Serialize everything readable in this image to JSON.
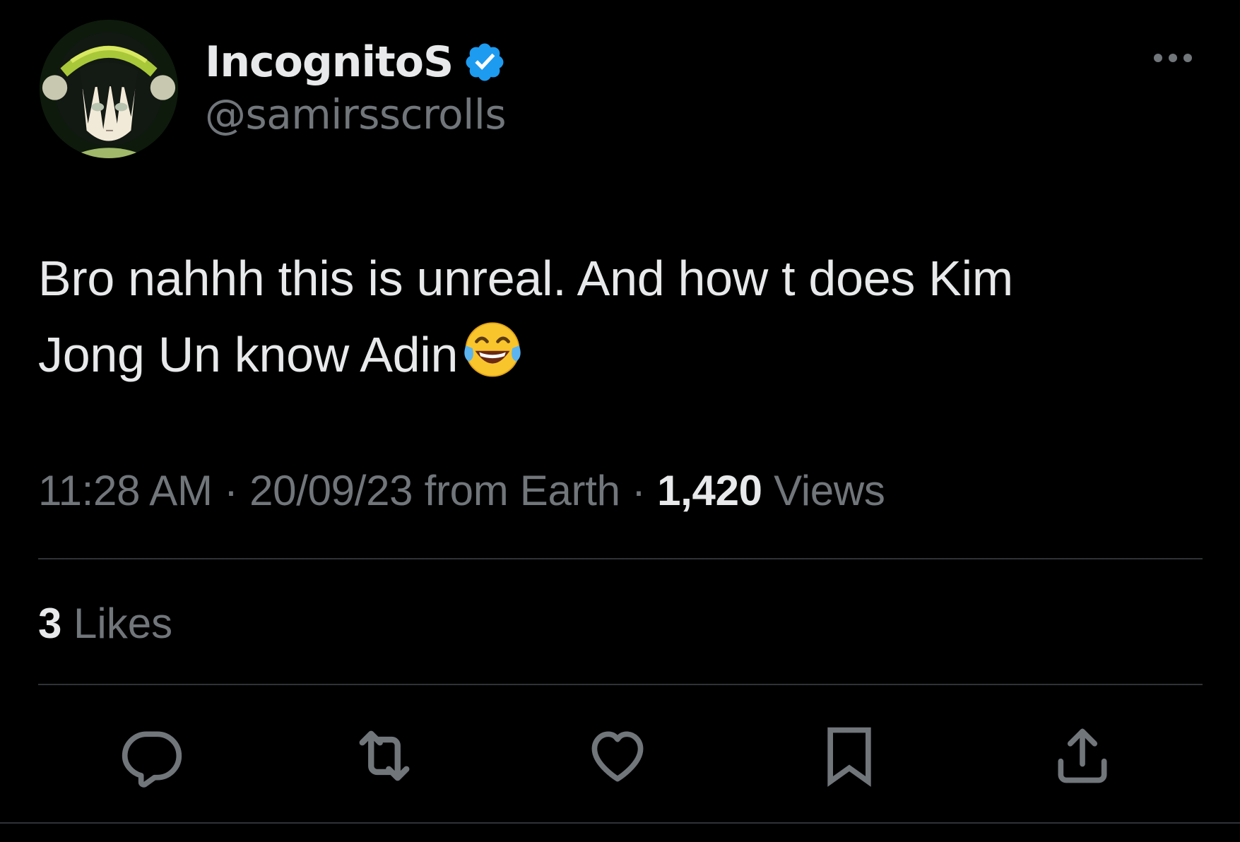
{
  "user": {
    "display_name": "IncognitoS",
    "handle": "@samirsscrolls",
    "verified": true,
    "verified_color": "#1d9bf0"
  },
  "tweet": {
    "line1": "Bro nahhh this is unreal. And how t  does Kim",
    "line2": "Jong Un know Adin",
    "emoji": "face-with-tears-of-joy"
  },
  "meta": {
    "time": "11:28 AM",
    "sep1": " · ",
    "date_source": "20/09/23 from Earth",
    "sep2": " · ",
    "views_count": "1,420",
    "views_label": " Views"
  },
  "stats": {
    "likes_count": "3",
    "likes_label": " Likes"
  },
  "actions": [
    {
      "name": "reply",
      "icon": "reply-icon"
    },
    {
      "name": "retweet",
      "icon": "retweet-icon"
    },
    {
      "name": "like",
      "icon": "heart-icon"
    },
    {
      "name": "bookmark",
      "icon": "bookmark-icon"
    },
    {
      "name": "share",
      "icon": "share-icon"
    }
  ],
  "colors": {
    "background": "#000000",
    "text_primary": "#e7e9ea",
    "text_secondary": "#71767b",
    "divider": "#2f3336"
  }
}
